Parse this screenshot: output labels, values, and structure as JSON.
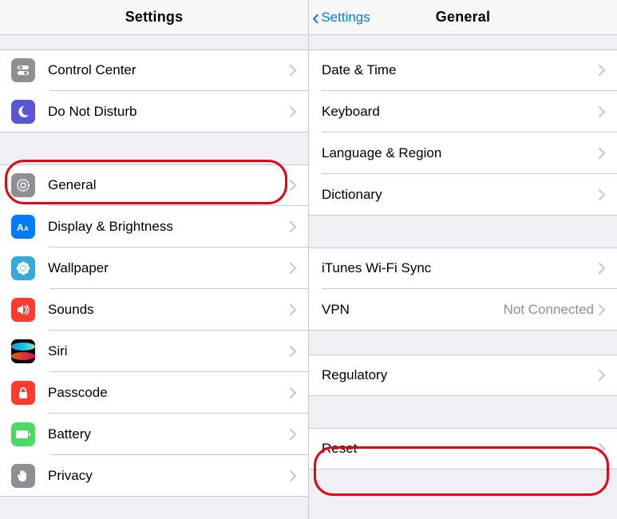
{
  "left": {
    "title": "Settings",
    "items_top": [
      {
        "key": "control-center",
        "label": "Control Center",
        "icon": "toggles-icon",
        "bg": "i-gray"
      },
      {
        "key": "do-not-disturb",
        "label": "Do Not Disturb",
        "icon": "moon-icon",
        "bg": "i-purple"
      }
    ],
    "items_bottom": [
      {
        "key": "general",
        "label": "General",
        "icon": "gear-icon",
        "bg": "i-gray"
      },
      {
        "key": "display-brightness",
        "label": "Display & Brightness",
        "icon": "text-size-icon",
        "bg": "i-blue"
      },
      {
        "key": "wallpaper",
        "label": "Wallpaper",
        "icon": "flower-icon",
        "bg": "i-teal"
      },
      {
        "key": "sounds",
        "label": "Sounds",
        "icon": "speaker-icon",
        "bg": "i-red"
      },
      {
        "key": "siri",
        "label": "Siri",
        "icon": "siri-icon",
        "bg": "i-siri"
      },
      {
        "key": "passcode",
        "label": "Passcode",
        "icon": "lock-icon",
        "bg": "i-red"
      },
      {
        "key": "battery",
        "label": "Battery",
        "icon": "battery-icon",
        "bg": "i-green"
      },
      {
        "key": "privacy",
        "label": "Privacy",
        "icon": "hand-icon",
        "bg": "i-gray"
      }
    ]
  },
  "right": {
    "back_label": "Settings",
    "title": "General",
    "group1": [
      {
        "key": "date-time",
        "label": "Date & Time"
      },
      {
        "key": "keyboard",
        "label": "Keyboard"
      },
      {
        "key": "language-region",
        "label": "Language & Region"
      },
      {
        "key": "dictionary",
        "label": "Dictionary"
      }
    ],
    "group2": [
      {
        "key": "itunes-wifi-sync",
        "label": "iTunes Wi-Fi Sync"
      },
      {
        "key": "vpn",
        "label": "VPN",
        "detail": "Not Connected"
      }
    ],
    "group3": [
      {
        "key": "regulatory",
        "label": "Regulatory"
      }
    ],
    "group4": [
      {
        "key": "reset",
        "label": "Reset"
      }
    ]
  }
}
